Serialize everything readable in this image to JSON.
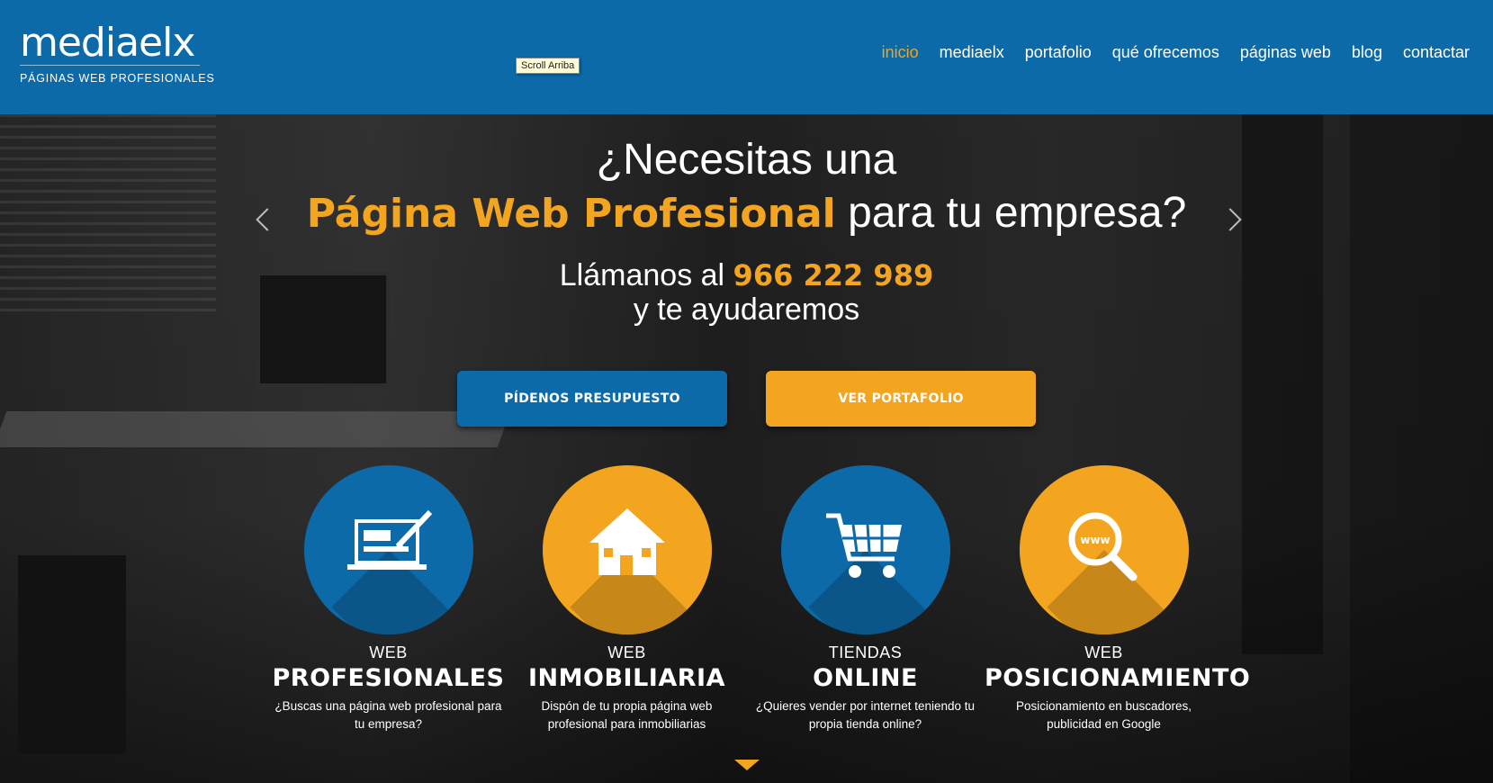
{
  "header": {
    "logo": "mediaelx",
    "tagline": "PÁGINAS WEB PROFESIONALES",
    "tooltip": "Scroll Arriba",
    "nav": [
      "inicio",
      "mediaelx",
      "portafolio",
      "qué ofrecemos",
      "páginas web",
      "blog",
      "contactar"
    ]
  },
  "hero": {
    "line1": "¿Necesitas una",
    "line2_highlight": "Página Web Profesional",
    "line2_rest": " para tu empresa?",
    "line3_text": "Llámanos al ",
    "line3_phone": "966 222 989",
    "line4": "y te ayudaremos",
    "btn_quote": "PÍDENOS PRESUPUESTO",
    "btn_portfolio": "VER PORTAFOLIO"
  },
  "services": [
    {
      "small": "WEB",
      "big": "PROFESIONALES",
      "desc1": "¿Buscas una página web profesional para",
      "desc2": "tu empresa?",
      "icon": "laptop-pen-icon"
    },
    {
      "small": "WEB",
      "big": "INMOBILIARIA",
      "desc1": "Dispón de tu propia página web",
      "desc2": "profesional para inmobiliarias",
      "icon": "house-icon"
    },
    {
      "small": "TIENDAS",
      "big": "ONLINE",
      "desc1": "¿Quieres vender por internet teniendo tu",
      "desc2": "propia tienda online?",
      "icon": "cart-icon"
    },
    {
      "small": "WEB",
      "big": "POSICIONAMIENTO",
      "desc1": "Posicionamiento en buscadores,",
      "desc2": "publicidad en Google",
      "icon": "magnifier-icon"
    }
  ],
  "colors": {
    "brand_blue": "#0d6aa8",
    "accent_orange": "#f3a51f"
  }
}
